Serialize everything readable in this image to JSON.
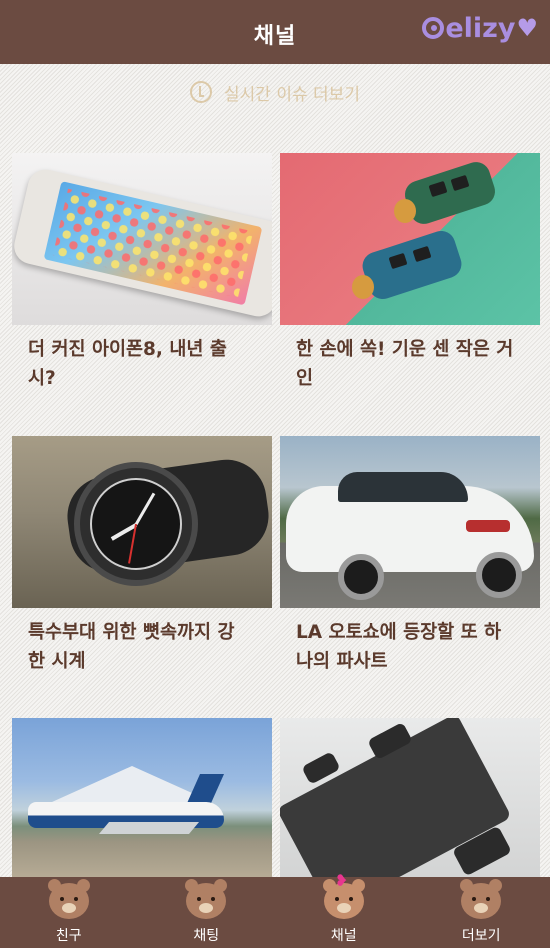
{
  "header": {
    "title": "채널",
    "logo_text": "elizy",
    "logo_color": "#a98ee0"
  },
  "live_issue": {
    "label": "실시간 이슈 더보기",
    "icon": "clock-icon"
  },
  "cards": [
    {
      "title": "더 커진 아이폰8, 내년 출 시?",
      "image": "iphone-image"
    },
    {
      "title": "한 손에 쏙! 기운 센 작은 거인",
      "image": "flashlights-image"
    },
    {
      "title": "특수부대 위한 뼛속까지 강 한 시계",
      "image": "watch-image"
    },
    {
      "title": "LA 오토쇼에 등장할 또 하 나의 파사트",
      "image": "car-image"
    },
    {
      "title": "",
      "image": "airplane-image"
    },
    {
      "title": "",
      "image": "modular-device-image"
    }
  ],
  "tabbar": {
    "items": [
      {
        "label": "친구",
        "icon": "bear-icon",
        "active": false
      },
      {
        "label": "채팅",
        "icon": "bear-icon",
        "active": false
      },
      {
        "label": "채널",
        "icon": "bear-with-bow-icon",
        "active": true
      },
      {
        "label": "더보기",
        "icon": "bear-icon",
        "active": false
      }
    ]
  },
  "colors": {
    "header_bg": "#6b4b41",
    "title_text": "#5b3a2c",
    "live_text": "#dcc9a8"
  }
}
